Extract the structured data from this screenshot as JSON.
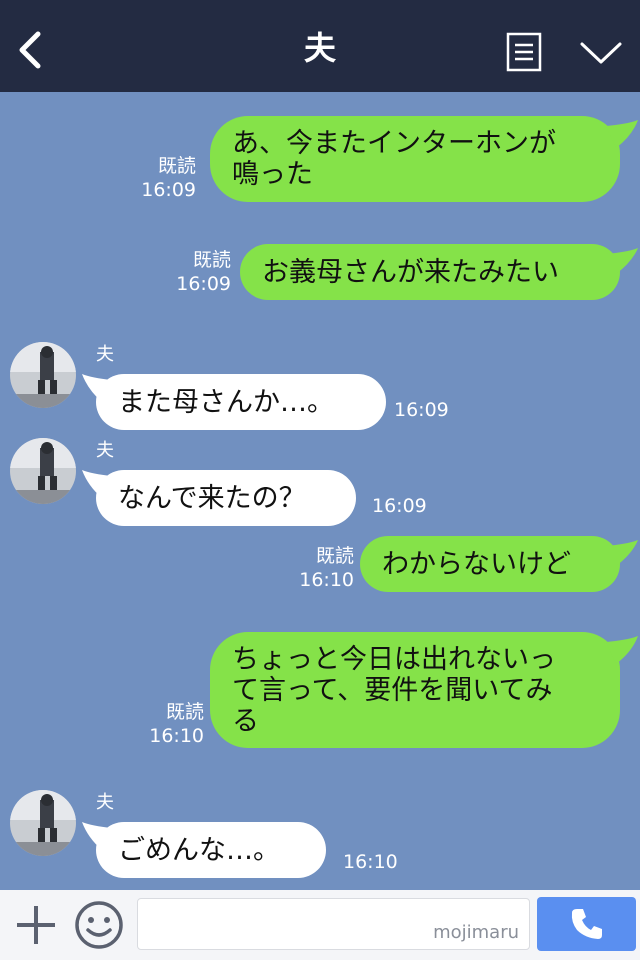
{
  "header": {
    "title": "夫",
    "back_icon": "chevron-left-icon",
    "menu_icon": "menu-list-icon",
    "expand_icon": "chevron-down-icon"
  },
  "messages": [
    {
      "from": "me",
      "text": "あ、今またインターホンが\n鳴った",
      "read": "既読",
      "time": "16:09"
    },
    {
      "from": "me",
      "text": "お義母さんが来たみたい",
      "read": "既読",
      "time": "16:09"
    },
    {
      "from": "them",
      "sender": "夫",
      "text": "また母さんか…。",
      "time": "16:09"
    },
    {
      "from": "them",
      "sender": "夫",
      "text": "なんで来たの？",
      "time": "16:09"
    },
    {
      "from": "me",
      "text": "わからないけど",
      "read": "既読",
      "time": "16:10"
    },
    {
      "from": "me",
      "text": "ちょっと今日は出れないっ\nて言って、要件を聞いてみ\nる",
      "read": "既読",
      "time": "16:10"
    },
    {
      "from": "them",
      "sender": "夫",
      "text": "ごめんな…。",
      "time": "16:10"
    }
  ],
  "footer": {
    "plus_icon": "plus-icon",
    "emoji_icon": "smile-icon",
    "watermark": "mojimaru",
    "call_icon": "phone-icon"
  },
  "colors": {
    "header": "#232b42",
    "background": "#7190c0",
    "my_bubble": "#85e249",
    "their_bubble": "#ffffff",
    "call_button": "#5a8ff0"
  }
}
